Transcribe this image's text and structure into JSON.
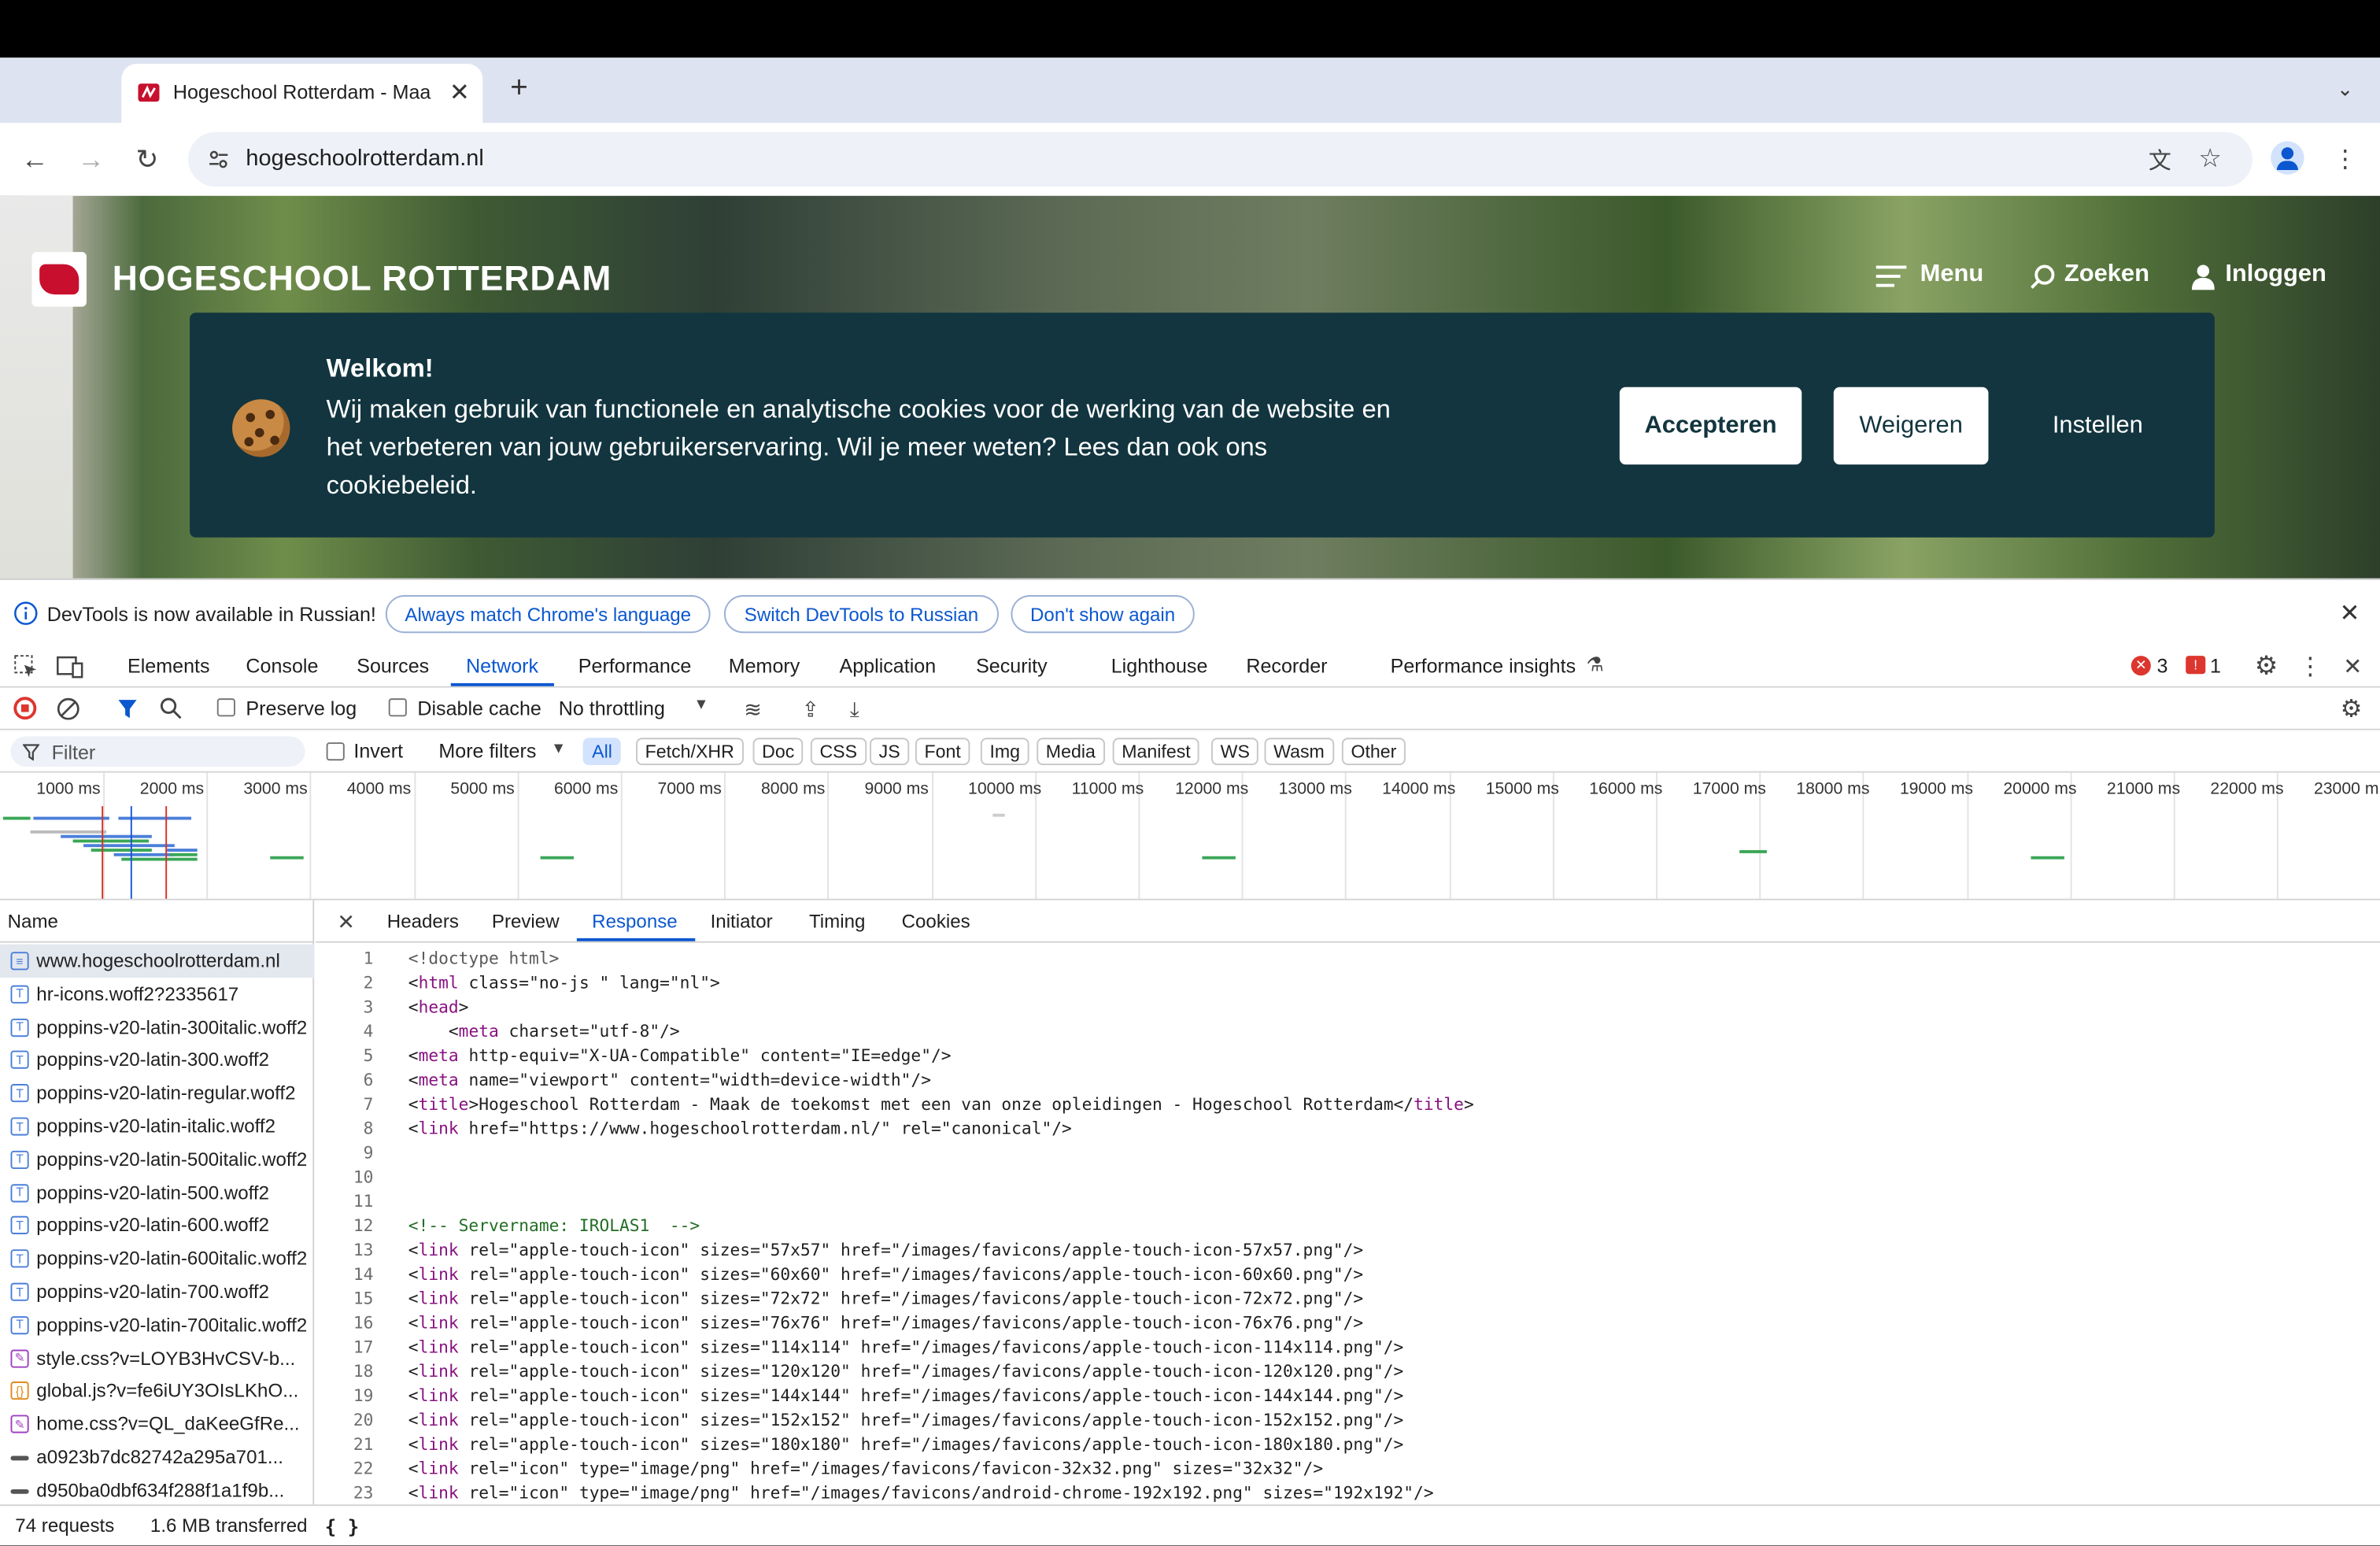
{
  "browser": {
    "tab_title": "Hogeschool Rotterdam - Maa",
    "new_tab_icon": "+",
    "url": "hogeschoolrotterdam.nl"
  },
  "site": {
    "brand": "HOGESCHOOL ROTTERDAM",
    "menu": "Menu",
    "search": "Zoeken",
    "login": "Inloggen",
    "cookie": {
      "title": "Welkom!",
      "text": "Wij maken gebruik van functionele en analytische cookies voor de werking van de website en het verbeteren van jouw gebruikerservaring. Wil je meer weten? Lees dan ook ons cookiebeleid.",
      "accept": "Accepteren",
      "decline": "Weigeren",
      "settings": "Instellen"
    }
  },
  "devtools": {
    "info": {
      "message": "DevTools is now available in Russian!",
      "match": "Always match Chrome's language",
      "switch": "Switch DevTools to Russian",
      "dont_show": "Don't show again"
    },
    "tabs": [
      "Elements",
      "Console",
      "Sources",
      "Network",
      "Performance",
      "Memory",
      "Application",
      "Security",
      "Lighthouse",
      "Recorder",
      "Performance insights"
    ],
    "active_tab": "Network",
    "errors": "3",
    "warnings": "1",
    "network_toolbar": {
      "preserve_log": "Preserve log",
      "disable_cache": "Disable cache",
      "throttling": "No throttling"
    },
    "filter": {
      "placeholder": "Filter",
      "invert": "Invert",
      "more_filters": "More filters",
      "types": [
        "All",
        "Fetch/XHR",
        "Doc",
        "CSS",
        "JS",
        "Font",
        "Img",
        "Media",
        "Manifest",
        "WS",
        "Wasm",
        "Other"
      ]
    },
    "timeline_labels": [
      "1000 ms",
      "2000 ms",
      "3000 ms",
      "4000 ms",
      "5000 ms",
      "6000 ms",
      "7000 ms",
      "8000 ms",
      "9000 ms",
      "10000 ms",
      "11000 ms",
      "12000 ms",
      "13000 ms",
      "14000 ms",
      "15000 ms",
      "16000 ms",
      "17000 ms",
      "18000 ms",
      "19000 ms",
      "20000 ms",
      "21000 ms",
      "22000 ms",
      "23000 m"
    ],
    "name_header": "Name",
    "requests": [
      {
        "name": "www.hogeschoolrotterdam.nl",
        "kind": "doc"
      },
      {
        "name": "hr-icons.woff2?2335617",
        "kind": "font"
      },
      {
        "name": "poppins-v20-latin-300italic.woff2",
        "kind": "font"
      },
      {
        "name": "poppins-v20-latin-300.woff2",
        "kind": "font"
      },
      {
        "name": "poppins-v20-latin-regular.woff2",
        "kind": "font"
      },
      {
        "name": "poppins-v20-latin-italic.woff2",
        "kind": "font"
      },
      {
        "name": "poppins-v20-latin-500italic.woff2",
        "kind": "font"
      },
      {
        "name": "poppins-v20-latin-500.woff2",
        "kind": "font"
      },
      {
        "name": "poppins-v20-latin-600.woff2",
        "kind": "font"
      },
      {
        "name": "poppins-v20-latin-600italic.woff2",
        "kind": "font"
      },
      {
        "name": "poppins-v20-latin-700.woff2",
        "kind": "font"
      },
      {
        "name": "poppins-v20-latin-700italic.woff2",
        "kind": "font"
      },
      {
        "name": "style.css?v=LOYB3HvCSV-b...",
        "kind": "css"
      },
      {
        "name": "global.js?v=fe6iUY3OIsLKhO...",
        "kind": "js"
      },
      {
        "name": "home.css?v=QL_daKeeGfRe...",
        "kind": "css"
      },
      {
        "name": "a0923b7dc82742a295a701...",
        "kind": "other"
      },
      {
        "name": "d950ba0dbf634f288f1a1f9b...",
        "kind": "other"
      }
    ],
    "detail_tabs": [
      "Headers",
      "Preview",
      "Response",
      "Initiator",
      "Timing",
      "Cookies"
    ],
    "active_detail_tab": "Response",
    "code_lines": [
      "<!doctype html>",
      "<html class=\"no-js \" lang=\"nl\">",
      "<head>",
      "    <meta charset=\"utf-8\"/>",
      "<meta http-equiv=\"X-UA-Compatible\" content=\"IE=edge\"/>",
      "<meta name=\"viewport\" content=\"width=device-width\"/>",
      "<title>Hogeschool Rotterdam - Maak de toekomst met een van onze opleidingen - Hogeschool Rotterdam</title>",
      "<link href=\"https://www.hogeschoolrotterdam.nl/\" rel=\"canonical\"/>",
      "",
      "",
      "",
      "<!-- Servername: IROLAS1  -->",
      "<link rel=\"apple-touch-icon\" sizes=\"57x57\" href=\"/images/favicons/apple-touch-icon-57x57.png\"/>",
      "<link rel=\"apple-touch-icon\" sizes=\"60x60\" href=\"/images/favicons/apple-touch-icon-60x60.png\"/>",
      "<link rel=\"apple-touch-icon\" sizes=\"72x72\" href=\"/images/favicons/apple-touch-icon-72x72.png\"/>",
      "<link rel=\"apple-touch-icon\" sizes=\"76x76\" href=\"/images/favicons/apple-touch-icon-76x76.png\"/>",
      "<link rel=\"apple-touch-icon\" sizes=\"114x114\" href=\"/images/favicons/apple-touch-icon-114x114.png\"/>",
      "<link rel=\"apple-touch-icon\" sizes=\"120x120\" href=\"/images/favicons/apple-touch-icon-120x120.png\"/>",
      "<link rel=\"apple-touch-icon\" sizes=\"144x144\" href=\"/images/favicons/apple-touch-icon-144x144.png\"/>",
      "<link rel=\"apple-touch-icon\" sizes=\"152x152\" href=\"/images/favicons/apple-touch-icon-152x152.png\"/>",
      "<link rel=\"apple-touch-icon\" sizes=\"180x180\" href=\"/images/favicons/apple-touch-icon-180x180.png\"/>",
      "<link rel=\"icon\" type=\"image/png\" href=\"/images/favicons/favicon-32x32.png\" sizes=\"32x32\"/>",
      "<link rel=\"icon\" type=\"image/png\" href=\"/images/favicons/android-chrome-192x192.png\" sizes=\"192x192\"/>"
    ],
    "status": {
      "requests": "74 requests",
      "transferred": "1.6 MB transferred",
      "pretty_print": "{ }"
    }
  }
}
